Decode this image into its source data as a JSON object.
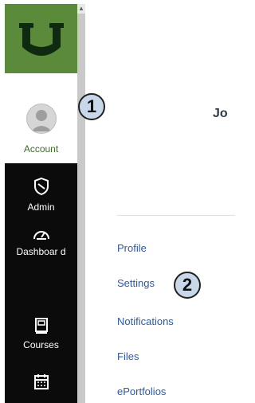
{
  "colors": {
    "nav_background": "#0b0b0b",
    "logo_background": "#5a8a3a",
    "account_label": "#3c6e2a",
    "link": "#2b5aa6",
    "callout_fill": "#c8d8ea"
  },
  "global_nav": {
    "logo_icon": "university-shield-logo",
    "account": {
      "label": "Account",
      "icon": "user-avatar-icon"
    },
    "items": [
      {
        "label": "Admin",
        "icon": "shield-admin-icon"
      },
      {
        "label": "Dashboar d",
        "icon": "dashboard-gauge-icon"
      },
      {
        "label": "Courses",
        "icon": "book-icon"
      },
      {
        "label": "",
        "icon": "calendar-icon"
      }
    ]
  },
  "header": {
    "user_name": "Jo"
  },
  "account_menu": {
    "links": [
      "Profile",
      "Settings",
      "Notifications",
      "Files",
      "ePortfolios"
    ]
  },
  "callouts": {
    "one": "1",
    "two": "2"
  }
}
